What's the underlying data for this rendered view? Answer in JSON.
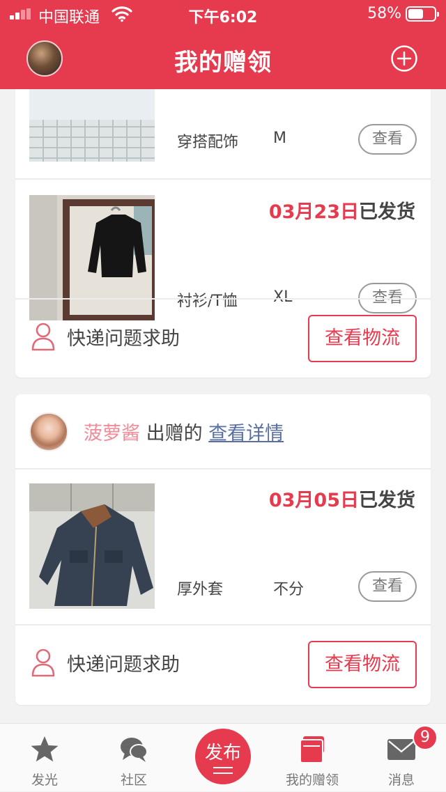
{
  "status_bar": {
    "carrier": "中国联通",
    "time": "下午6:02",
    "battery": "58%",
    "battery_level": 0.58,
    "signal_bars": 2
  },
  "header": {
    "title": "我的赠领",
    "avatar_icon": "user-avatar",
    "add_icon": "plus-circle-icon"
  },
  "colors": {
    "brand": "#e63b4f",
    "text": "#444444",
    "muted": "#777777",
    "link": "#5a6fa1",
    "giver_name": "#f08c9a"
  },
  "cards": [
    {
      "items": [
        {
          "date": "",
          "status": "",
          "category": "穿搭配饰",
          "size": "M",
          "view_label": "查看"
        },
        {
          "date": "03月23日",
          "status": "已发货",
          "category": "衬衫/T恤",
          "size": "XL",
          "view_label": "查看"
        }
      ],
      "help_label": "快递问题求助",
      "logistics_label": "查看物流"
    },
    {
      "giver": {
        "name": "菠萝酱",
        "action": "出赠的",
        "link": "查看详情"
      },
      "items": [
        {
          "date": "03月05日",
          "status": "已发货",
          "category": "厚外套",
          "size": "不分",
          "view_label": "查看"
        }
      ],
      "help_label": "快递问题求助",
      "logistics_label": "查看物流"
    }
  ],
  "tabbar": {
    "tabs": [
      {
        "label": "发光",
        "icon": "star-icon"
      },
      {
        "label": "社区",
        "icon": "chat-bubbles-icon"
      },
      {
        "label": "发布",
        "icon": "publish-icon"
      },
      {
        "label": "我的赠领",
        "icon": "cards-icon",
        "active": true
      },
      {
        "label": "消息",
        "icon": "mail-icon"
      }
    ],
    "message_badge": "9"
  }
}
